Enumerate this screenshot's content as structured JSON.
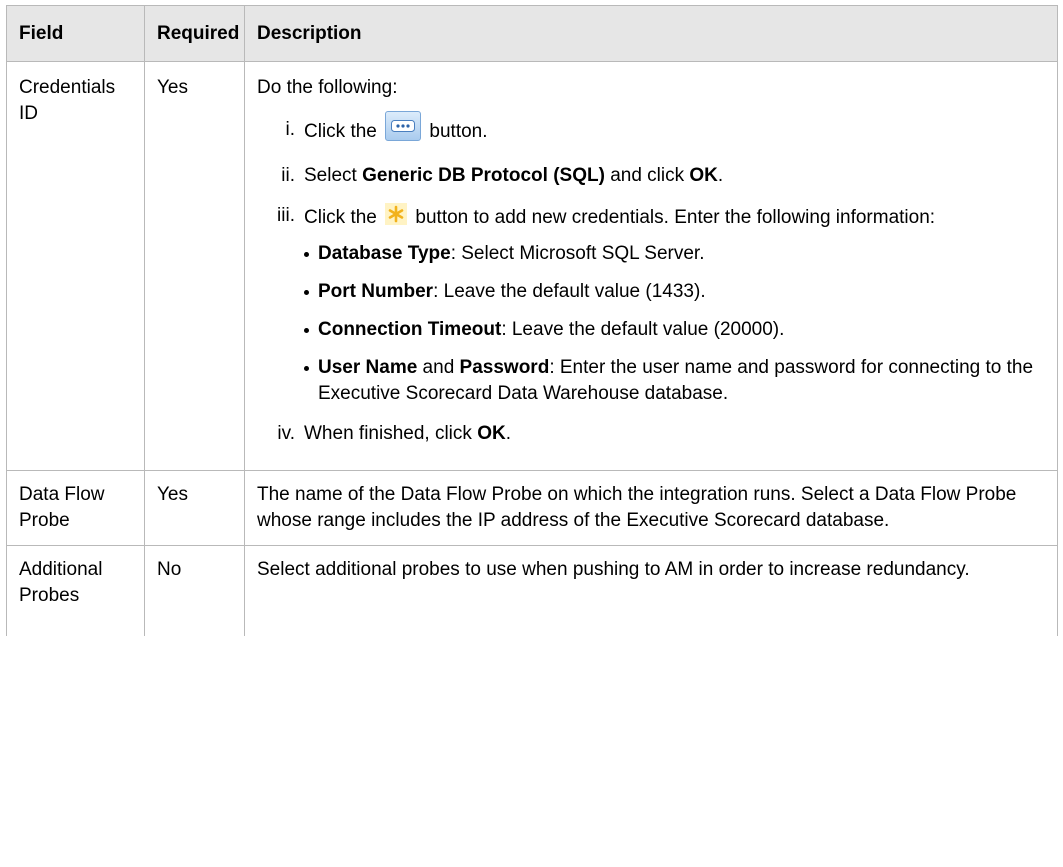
{
  "table": {
    "headers": [
      "Field",
      "Required",
      "Description"
    ],
    "rows": [
      {
        "field": "Credentials ID",
        "required": "Yes",
        "intro": "Do the following:",
        "steps": [
          {
            "num": "i.",
            "pre": "Click the",
            "icon": "ellipsis-button-icon",
            "post": "button."
          },
          {
            "num": "ii.",
            "pre": "Select",
            "bold1": "Generic DB Protocol (SQL)",
            "mid": "and click",
            "bold2": "OK",
            "post": "."
          },
          {
            "num": "iii.",
            "pre": "Click the",
            "icon": "asterisk-new-icon",
            "post": "button to add new credentials. Enter the following information:",
            "bullets": [
              {
                "bold": "Database Type",
                "text": ": Select Microsoft SQL Server."
              },
              {
                "bold": "Port Number",
                "text": ": Leave the default value (1433)."
              },
              {
                "bold": "Connection Timeout",
                "text": ": Leave the default value (20000)."
              },
              {
                "bold": "User Name",
                "mid": " and ",
                "bold2": "Password",
                "text": ": Enter the user name and password for connecting to the Executive Scorecard Data Warehouse database."
              }
            ]
          },
          {
            "num": "iv.",
            "pre": "When finished, click",
            "bold1": "OK",
            "post": "."
          }
        ]
      },
      {
        "field": "Data Flow Probe",
        "required": "Yes",
        "description": "The name of the Data Flow Probe on which the integration runs. Select a Data Flow Probe whose range includes the IP address of the Executive Scorecard database."
      },
      {
        "field": "Additional Probes",
        "required": "No",
        "description": "Select additional probes to use when pushing to AM in order to increase redundancy."
      }
    ]
  }
}
